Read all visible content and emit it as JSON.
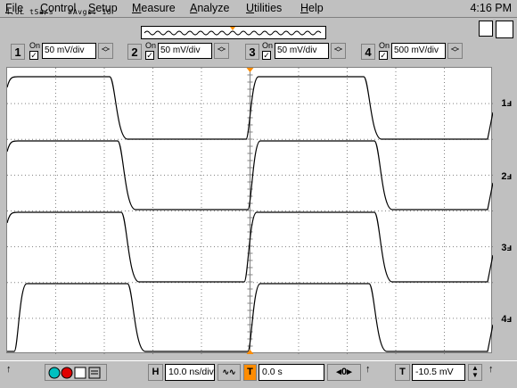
{
  "menu": {
    "items": [
      "File",
      "Control",
      "Setup",
      "Measure",
      "Analyze",
      "Utilities",
      "Help"
    ],
    "clock": "4:16 PM"
  },
  "status": {
    "text": "4.UL tSa/s   #Avgs: 16"
  },
  "channels": [
    {
      "number": "1",
      "on_label": "On",
      "scale": "50 mV/div",
      "checked": true
    },
    {
      "number": "2",
      "on_label": "On",
      "scale": "50 mV/div",
      "checked": true
    },
    {
      "number": "3",
      "on_label": "On",
      "scale": "50 mV/div",
      "checked": true
    },
    {
      "number": "4",
      "on_label": "On",
      "scale": "500 mV/div",
      "checked": true
    }
  ],
  "markers": [
    "1",
    "2",
    "3",
    "4"
  ],
  "bottom": {
    "h_label": "H",
    "timebase": "10.0 ns/div",
    "delay": "0.0 s",
    "ref_label": "0",
    "t_label": "T",
    "trigger_level": "-10.5 mV"
  },
  "colors": {
    "background": "#c0c0c0",
    "grid": "#808080",
    "trigger_marker": "#ff8c00",
    "run_cyan": "#00c0c0",
    "stop_red": "#e00000"
  }
}
